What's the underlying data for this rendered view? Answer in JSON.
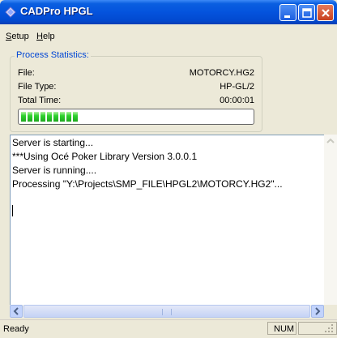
{
  "window": {
    "title": "CADPro HPGL",
    "controls": {
      "minimize": "minimize",
      "maximize": "maximize",
      "close": "close"
    }
  },
  "menu": {
    "items": [
      {
        "label": "Setup",
        "accel": "S",
        "rest": "etup"
      },
      {
        "label": "Help",
        "accel": "H",
        "rest": "elp"
      }
    ]
  },
  "stats": {
    "group_title": "Process Statistics:",
    "rows": [
      {
        "label": "File:",
        "value": "MOTORCY.HG2"
      },
      {
        "label": "File Type:",
        "value": "HP-GL/2"
      },
      {
        "label": "Total Time:",
        "value": "00:00:01"
      }
    ],
    "progress_fraction": 0.24
  },
  "log": {
    "lines": [
      "Server is starting...",
      "***Using Océ Poker Library Version 3.0.0.1",
      "Server is running....",
      "Processing \"Y:\\Projects\\SMP_FILE\\HPGL2\\MOTORCY.HG2\"..."
    ]
  },
  "status": {
    "text": "Ready",
    "num": "NUM"
  },
  "colors": {
    "titlebar": "#0453dd",
    "group_title": "#0046d5",
    "progress": "#2ed22e"
  }
}
